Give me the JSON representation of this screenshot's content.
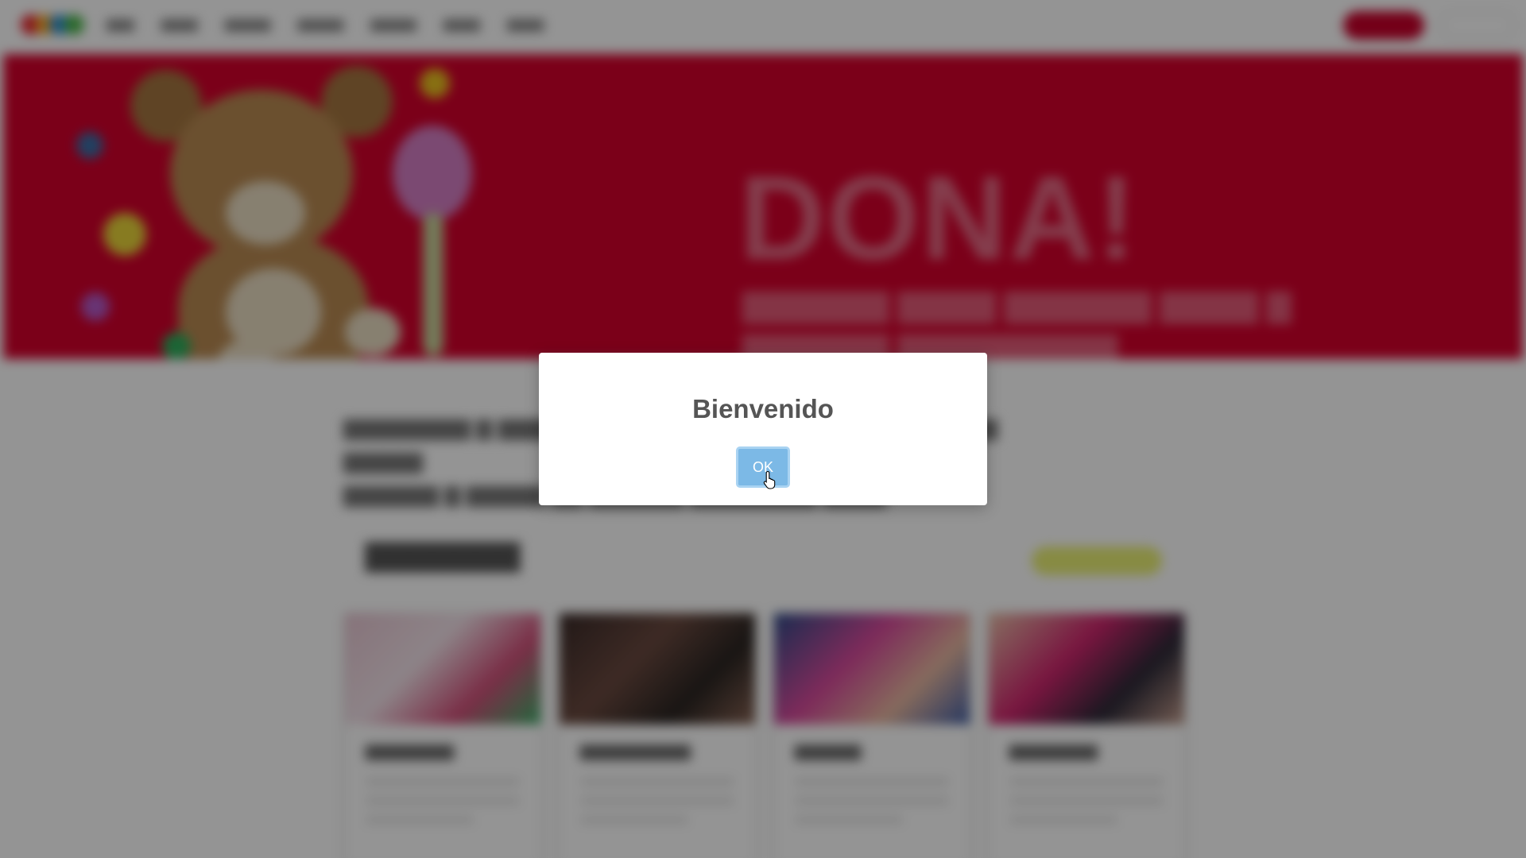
{
  "dialog": {
    "title": "Bienvenido",
    "ok_label": "OK",
    "button_color": "#7cb9e6"
  },
  "background": {
    "hero": {
      "title": "DONA!",
      "color": "#d5002c"
    },
    "brand_color": "#c8002a",
    "accent_pill_color": "#e9ef74"
  },
  "icons": {
    "cursor": "hand-pointer-icon",
    "logo": "logo-icon"
  }
}
